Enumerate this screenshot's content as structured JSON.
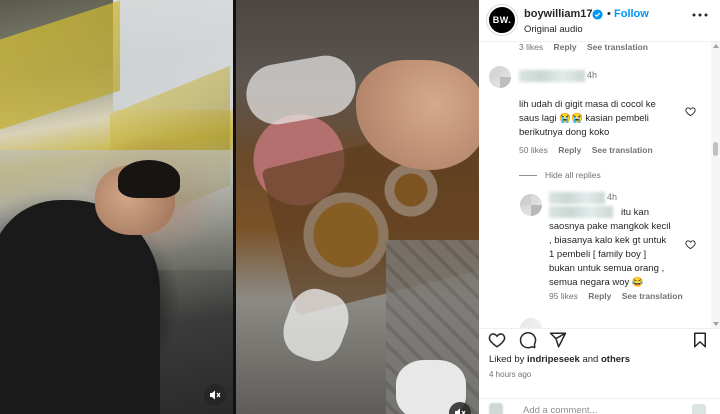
{
  "post": {
    "username": "boywilliam17",
    "follow_label": "Follow",
    "separator": "•",
    "audio": "Original audio",
    "avatar_text": "BW."
  },
  "comments": {
    "prev_meta": {
      "likes": "3 likes",
      "reply": "Reply",
      "translate": "See translation"
    },
    "comment1": {
      "time": "4h",
      "lines": [
        "lih udah di gigit masa di cocol ke",
        "saus lagi 😭😭 kasian pembeli",
        "berikutnya dong koko"
      ],
      "likes": "50 likes",
      "reply": "Reply",
      "translate": "See translation"
    },
    "hide_replies": "Hide all replies",
    "reply1": {
      "time": "4h",
      "lines": [
        "itu kan",
        "saosnya pake mangkok kecil",
        ", biasanya kalo kek gt untuk",
        "1 pembeli [ family boy ]",
        "bukan untuk semua orang ,",
        "semua negara woy 😂"
      ],
      "likes": "95 likes",
      "reply": "Reply",
      "translate": "See translation"
    }
  },
  "footer": {
    "liked_prefix": "Liked by ",
    "liked_user": "indripeseek",
    "liked_mid": " and ",
    "liked_suffix": "others",
    "time_ago": "4 hours ago",
    "add_comment_placeholder": "Add a comment..."
  },
  "icons": {
    "heart": "heart-icon",
    "comment": "comment-icon",
    "share": "share-icon",
    "save": "bookmark-icon",
    "more": "more-icon",
    "verified": "verified-badge-icon",
    "audio": "speaker-muted-icon"
  },
  "colors": {
    "accent": "#0095f6",
    "text": "#262626",
    "muted": "#737373",
    "border": "#efefef"
  }
}
